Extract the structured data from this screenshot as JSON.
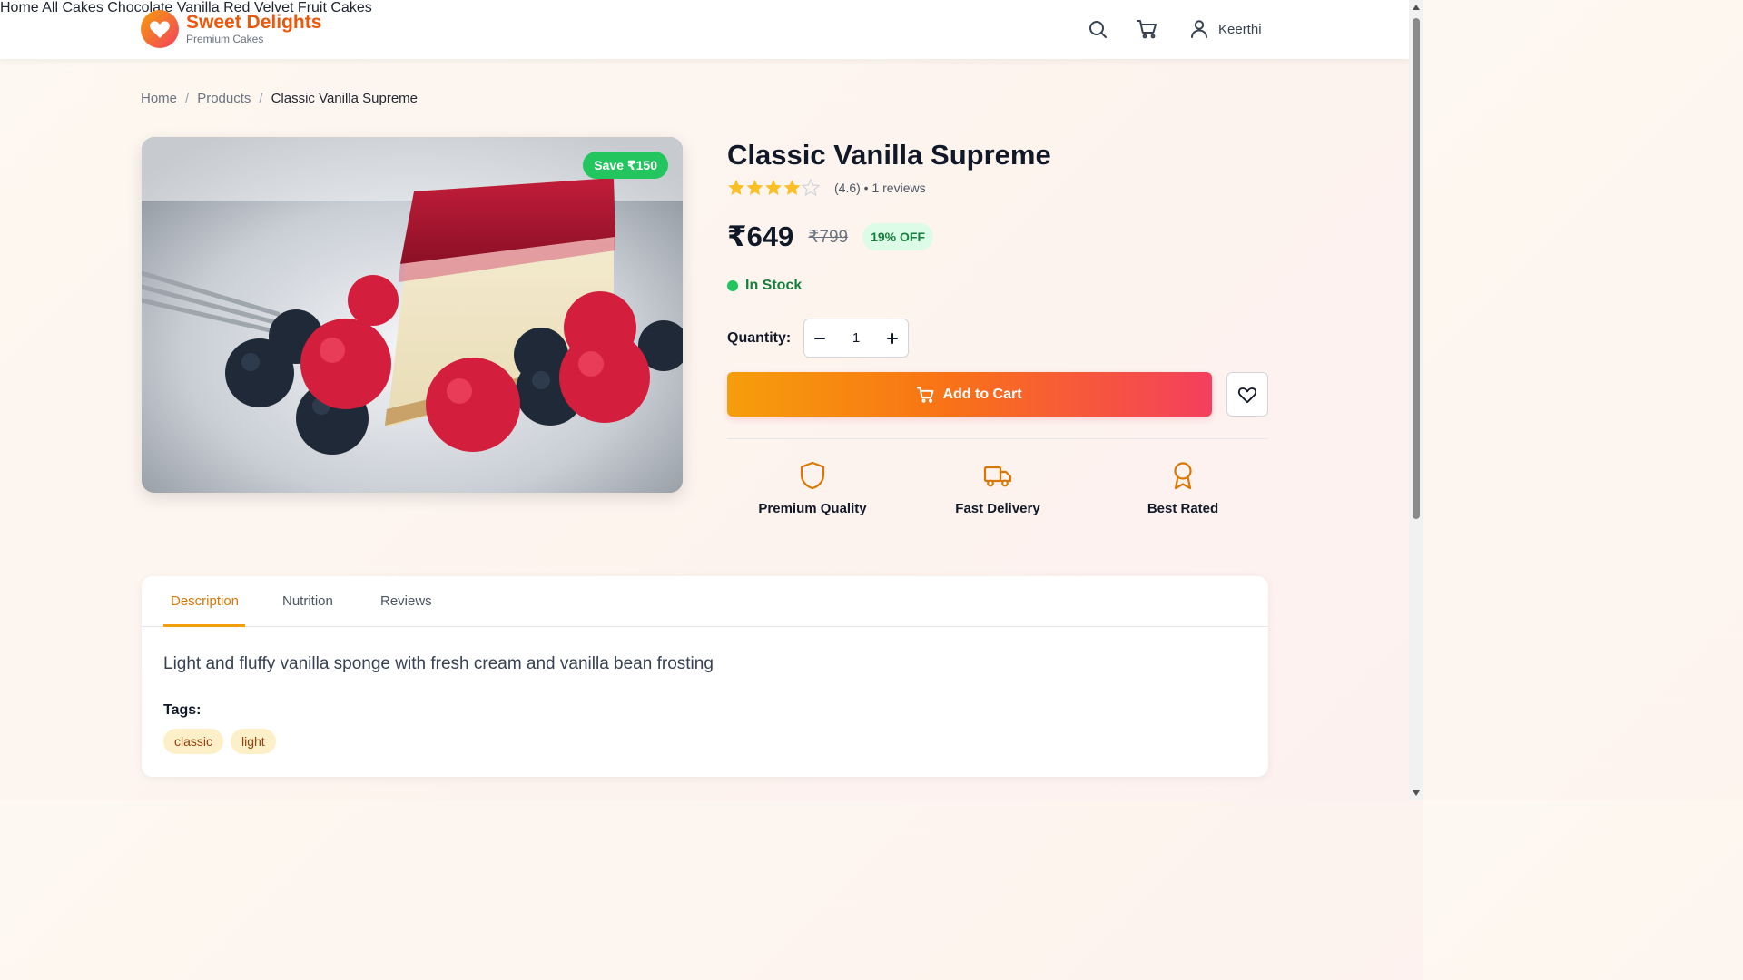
{
  "brand": {
    "name": "Sweet Delights",
    "tagline": "Premium Cakes"
  },
  "nav": {
    "items": [
      "Home",
      "All Cakes",
      "Chocolate",
      "Vanilla",
      "Red Velvet",
      "Fruit Cakes"
    ]
  },
  "header": {
    "user_name": "Keerthi"
  },
  "breadcrumb": {
    "home": "Home",
    "products": "Products",
    "current": "Classic Vanilla Supreme",
    "separator": "/"
  },
  "product": {
    "title": "Classic Vanilla Supreme",
    "save_badge": "Save ₹150",
    "rating": 4.6,
    "rating_text": "(4.6) • 1 reviews",
    "price": "₹649",
    "original_price": "₹799",
    "discount": "19% OFF",
    "stock": "In Stock",
    "quantity_label": "Quantity:",
    "quantity": "1",
    "add_to_cart": "Add to Cart"
  },
  "features": [
    "Premium Quality",
    "Fast Delivery",
    "Best Rated"
  ],
  "tabs": [
    "Description",
    "Nutrition",
    "Reviews"
  ],
  "description": {
    "text": "Light and fluffy vanilla sponge with fresh cream and vanilla bean frosting",
    "tags_label": "Tags:",
    "tags": [
      "classic",
      "light"
    ]
  },
  "colors": {
    "accent": "#f59e0b",
    "brand": "#ea580c",
    "success": "#22c55e",
    "cta_end": "#f43f5e"
  }
}
